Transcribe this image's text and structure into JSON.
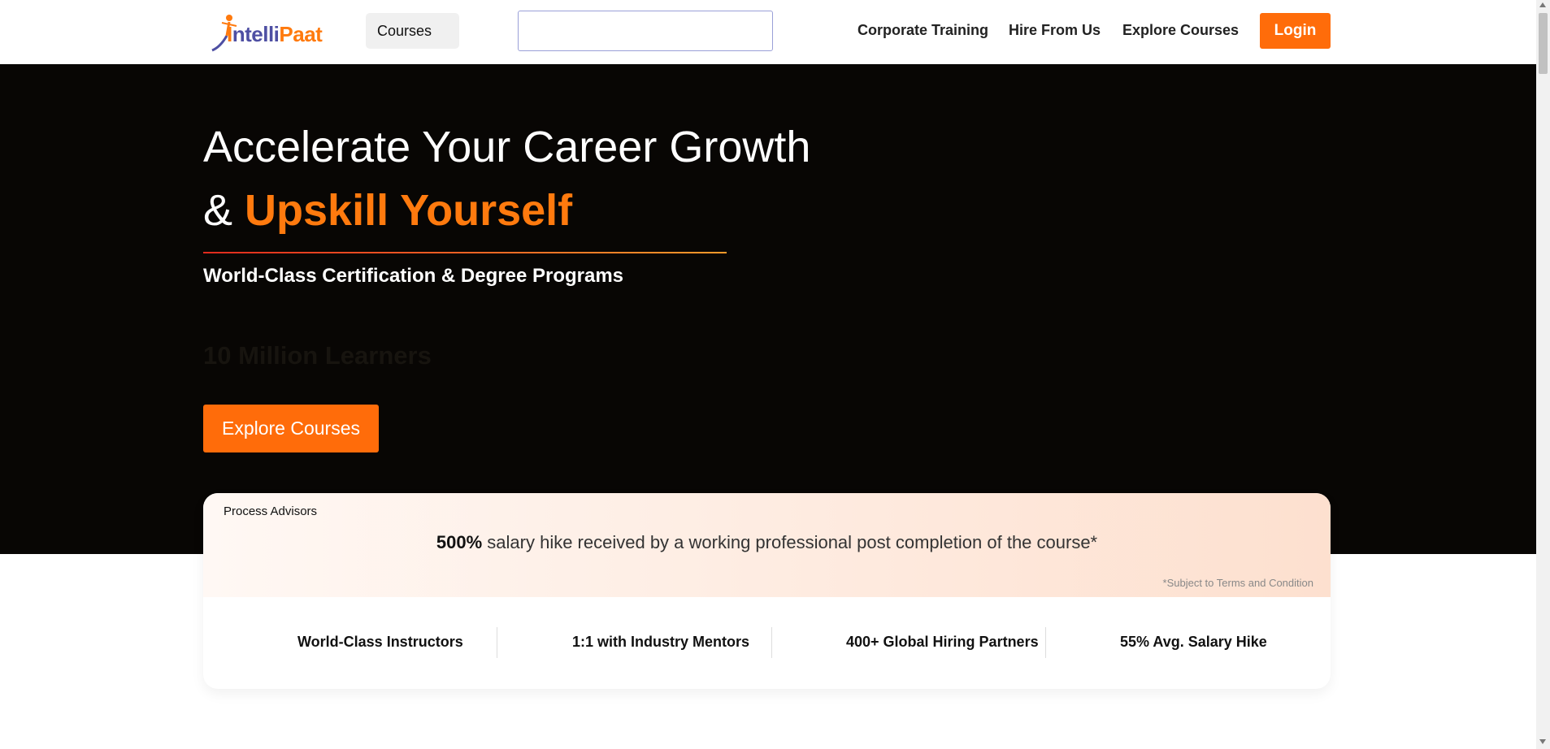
{
  "header": {
    "logo": {
      "part1": "I",
      "part2": "ntelli",
      "part3": "Paat"
    },
    "courses_label": "Courses",
    "search": {
      "value": "",
      "placeholder": ""
    },
    "nav": {
      "corporate_training": "Corporate Training",
      "hire_from_us": "Hire From Us",
      "explore_courses": "Explore Courses"
    },
    "login_label": "Login"
  },
  "hero": {
    "title_line1": "Accelerate Your Career Growth",
    "title_line2_prefix": "& ",
    "title_line2_highlight": "Upskill Yourself",
    "subtitle": "World-Class Certification & Degree Programs",
    "ghost_text": "10 Million Learners",
    "cta_label": "Explore Courses"
  },
  "info_card": {
    "tag": "Process Advisors",
    "highlight_value": "500%",
    "message": "salary hike received by a working professional post completion of the course*",
    "terms": "*Subject to Terms and Condition",
    "stats": [
      "World-Class Instructors",
      "1:1 with Industry Mentors",
      "400+ Global Hiring Partners",
      "55% Avg. Salary Hike"
    ]
  },
  "colors": {
    "accent": "#ff6c0a",
    "hero_bg": "#080604",
    "logo_purple": "#4e4fa3"
  }
}
